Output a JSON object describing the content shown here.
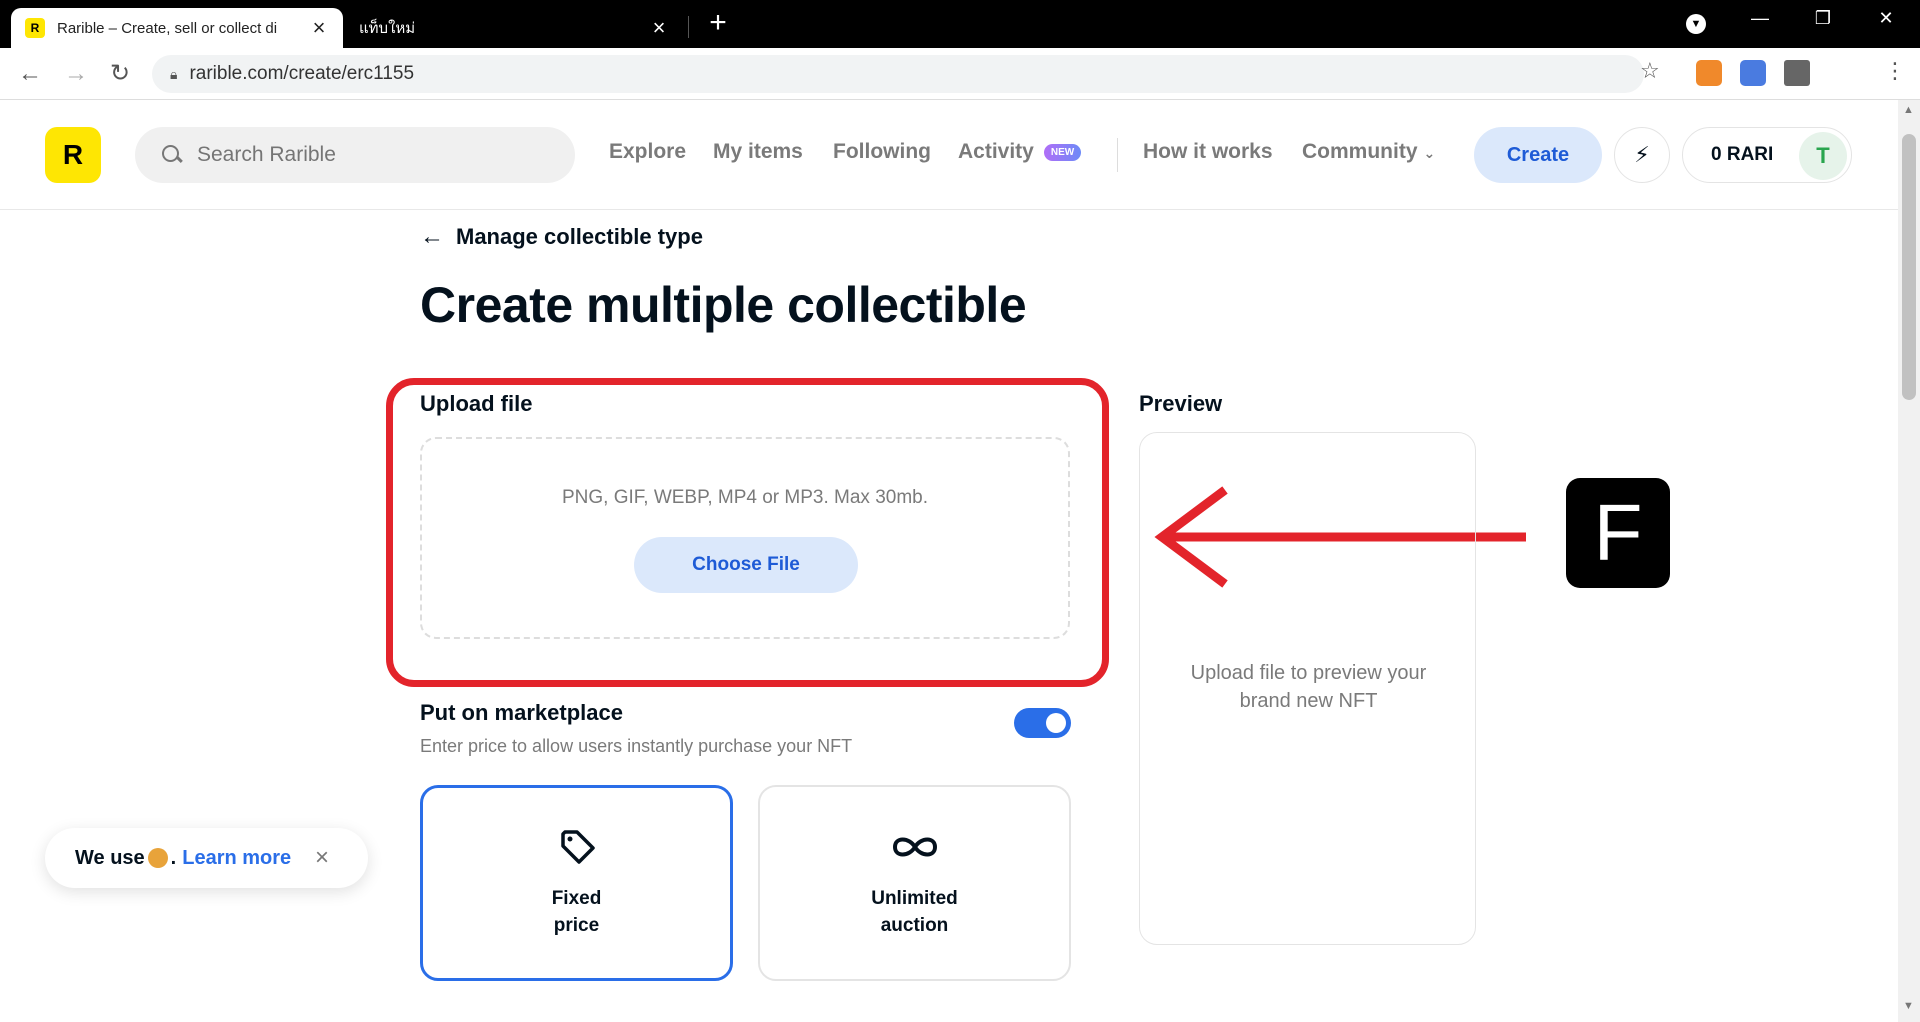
{
  "browser": {
    "active_tab_title": "Rarible – Create, sell or collect di",
    "inactive_tab_title": "แท็บใหม่",
    "url": "rarible.com/create/erc1155"
  },
  "header": {
    "logo_text": "R",
    "search_placeholder": "Search Rarible",
    "nav": {
      "explore": "Explore",
      "my_items": "My items",
      "following": "Following",
      "activity": "Activity",
      "activity_badge": "NEW",
      "how_it_works": "How it works",
      "community": "Community"
    },
    "create_label": "Create",
    "wallet_balance": "0 RARI"
  },
  "main": {
    "back_label": "Manage collectible type",
    "title": "Create multiple collectible",
    "upload": {
      "label": "Upload file",
      "hint": "PNG, GIF, WEBP, MP4 or MP3. Max 30mb.",
      "button": "Choose File"
    },
    "preview": {
      "label": "Preview",
      "placeholder_line1": "Upload file to preview your",
      "placeholder_line2": "brand new NFT"
    },
    "marketplace": {
      "label": "Put on marketplace",
      "description": "Enter price to allow users instantly purchase your NFT",
      "enabled": true,
      "options": [
        {
          "label": "Fixed price",
          "icon": "price-tag-icon",
          "selected": true
        },
        {
          "label": "Unlimited auction",
          "icon": "infinity-icon",
          "selected": false
        }
      ]
    }
  },
  "annotation": {
    "letter": "F",
    "color": "#e3242b"
  },
  "cookie": {
    "text_before": "We use",
    "text_after": ".",
    "link": "Learn more",
    "close": "×"
  },
  "colors": {
    "brand_yellow": "#fee603",
    "accent_blue": "#2a6ee8",
    "create_bg": "#dbe8fb"
  }
}
